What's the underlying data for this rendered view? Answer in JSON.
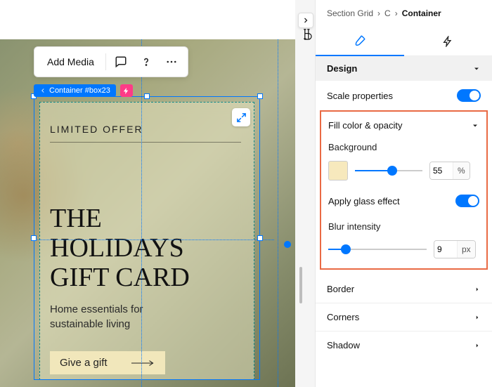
{
  "toolbar": {
    "add_media": "Add Media"
  },
  "selection": {
    "tag": "Container #box23"
  },
  "card": {
    "limited": "LIMITED OFFER",
    "heading_l1": "THE",
    "heading_l2": "HOLIDAYS",
    "heading_l3": "GIFT CARD",
    "sub_l1": "Home essentials for",
    "sub_l2": "sustainable living",
    "cta": "Give a gift"
  },
  "breadcrumb": {
    "a": "Section Grid",
    "b": "C",
    "c": "Container"
  },
  "panel": {
    "design": "Design",
    "scale": "Scale properties",
    "fill_head": "Fill color & opacity",
    "background": "Background",
    "opacity_value": "55",
    "opacity_unit": "%",
    "glass": "Apply glass effect",
    "blur_label": "Blur intensity",
    "blur_value": "9",
    "blur_unit": "px",
    "border": "Border",
    "corners": "Corners",
    "shadow": "Shadow"
  },
  "colors": {
    "swatch": "#f7e9bd",
    "accent": "#0077ff",
    "highlight": "#e96a44"
  }
}
